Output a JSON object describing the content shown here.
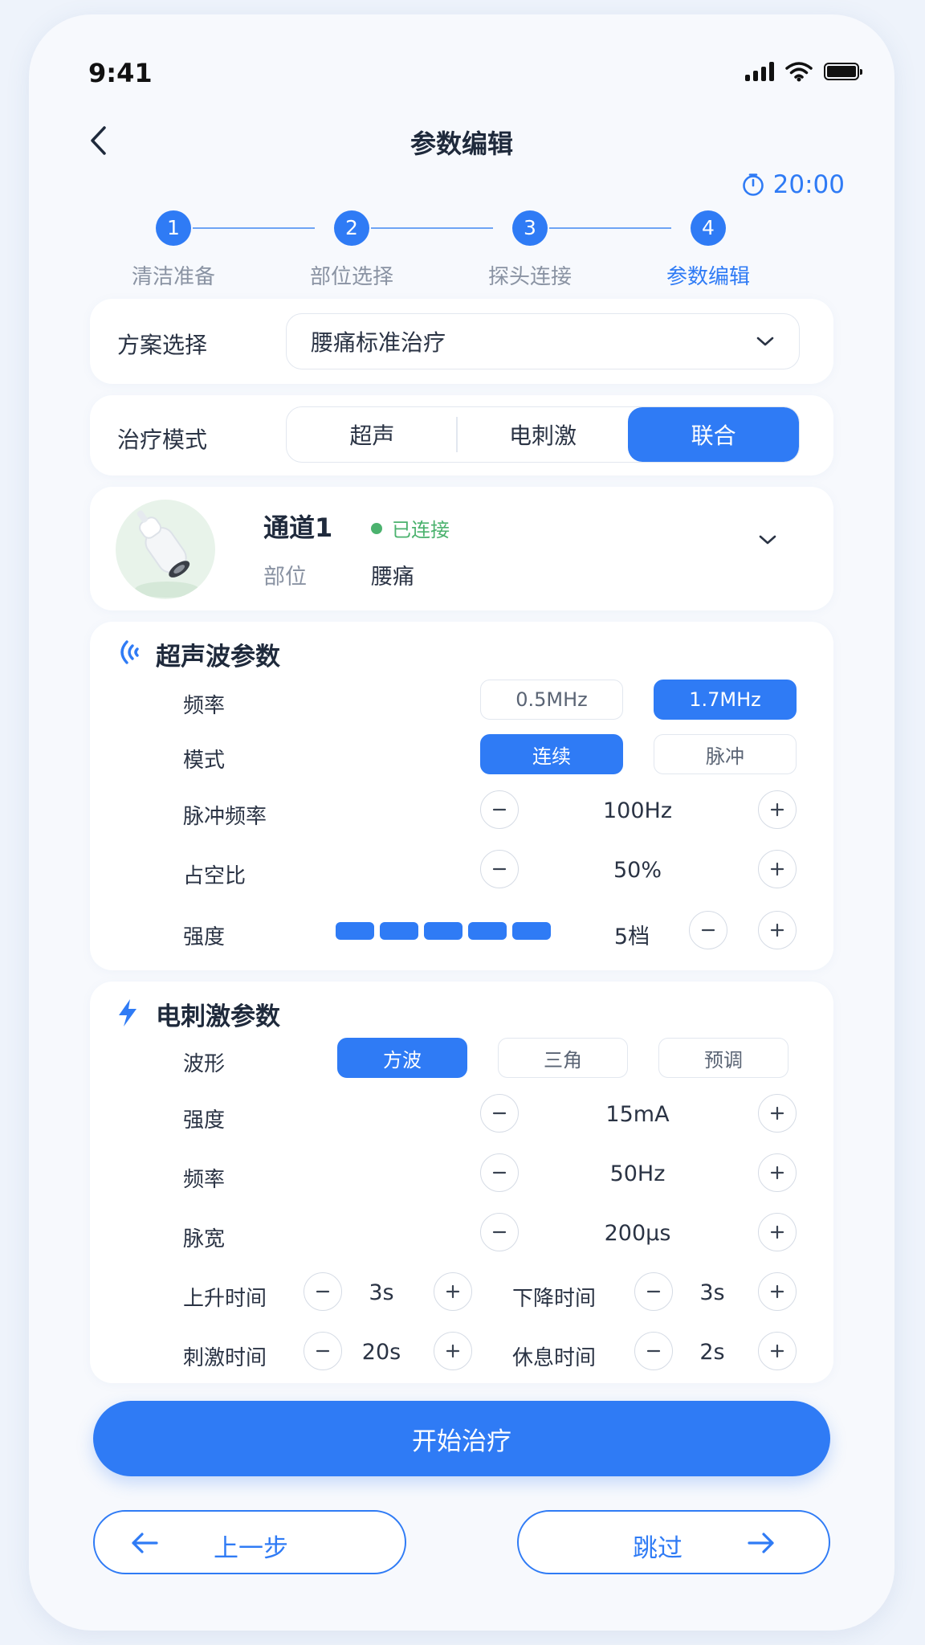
{
  "status_bar": {
    "time": "9:41"
  },
  "header": {
    "title": "参数编辑",
    "timer": "20:00"
  },
  "steps": [
    {
      "num": "1",
      "label": "清洁准备"
    },
    {
      "num": "2",
      "label": "部位选择"
    },
    {
      "num": "3",
      "label": "探头连接"
    },
    {
      "num": "4",
      "label": "参数编辑"
    }
  ],
  "current_step": 4,
  "plan": {
    "label": "方案选择",
    "value": "腰痛标准治疗"
  },
  "mode": {
    "label": "治疗模式",
    "options": [
      "超声",
      "电刺激",
      "联合"
    ],
    "selected": "联合"
  },
  "channel": {
    "title": "通道1",
    "status": "已连接",
    "part_label": "部位",
    "part_value": "腰痛"
  },
  "ultrasound": {
    "title": "超声波参数",
    "frequency": {
      "label": "频率",
      "options": [
        "0.5MHz",
        "1.7MHz"
      ],
      "selected": "1.7MHz"
    },
    "mode": {
      "label": "模式",
      "options": [
        "连续",
        "脉冲"
      ],
      "selected": "连续"
    },
    "pulse_freq": {
      "label": "脉冲频率",
      "value": "100Hz"
    },
    "duty": {
      "label": "占空比",
      "value": "50%"
    },
    "intensity": {
      "label": "强度",
      "value": "5档",
      "level": 5
    }
  },
  "estim": {
    "title": "电刺激参数",
    "waveform": {
      "label": "波形",
      "options": [
        "方波",
        "三角",
        "预调"
      ],
      "selected": "方波"
    },
    "intensity": {
      "label": "强度",
      "value": "15mA"
    },
    "frequency": {
      "label": "频率",
      "value": "50Hz"
    },
    "pulse_width": {
      "label": "脉宽",
      "value": "200μs"
    },
    "rise_time": {
      "label": "上升时间",
      "value": "3s"
    },
    "fall_time": {
      "label": "下降时间",
      "value": "3s"
    },
    "stim_time": {
      "label": "刺激时间",
      "value": "20s"
    },
    "rest_time": {
      "label": "休息时间",
      "value": "2s"
    }
  },
  "actions": {
    "start": "开始治疗",
    "prev": "上一步",
    "skip": "跳过"
  },
  "colors": {
    "accent": "#2f7bf5",
    "success": "#4bb26e",
    "background": "#f7f9fd"
  }
}
